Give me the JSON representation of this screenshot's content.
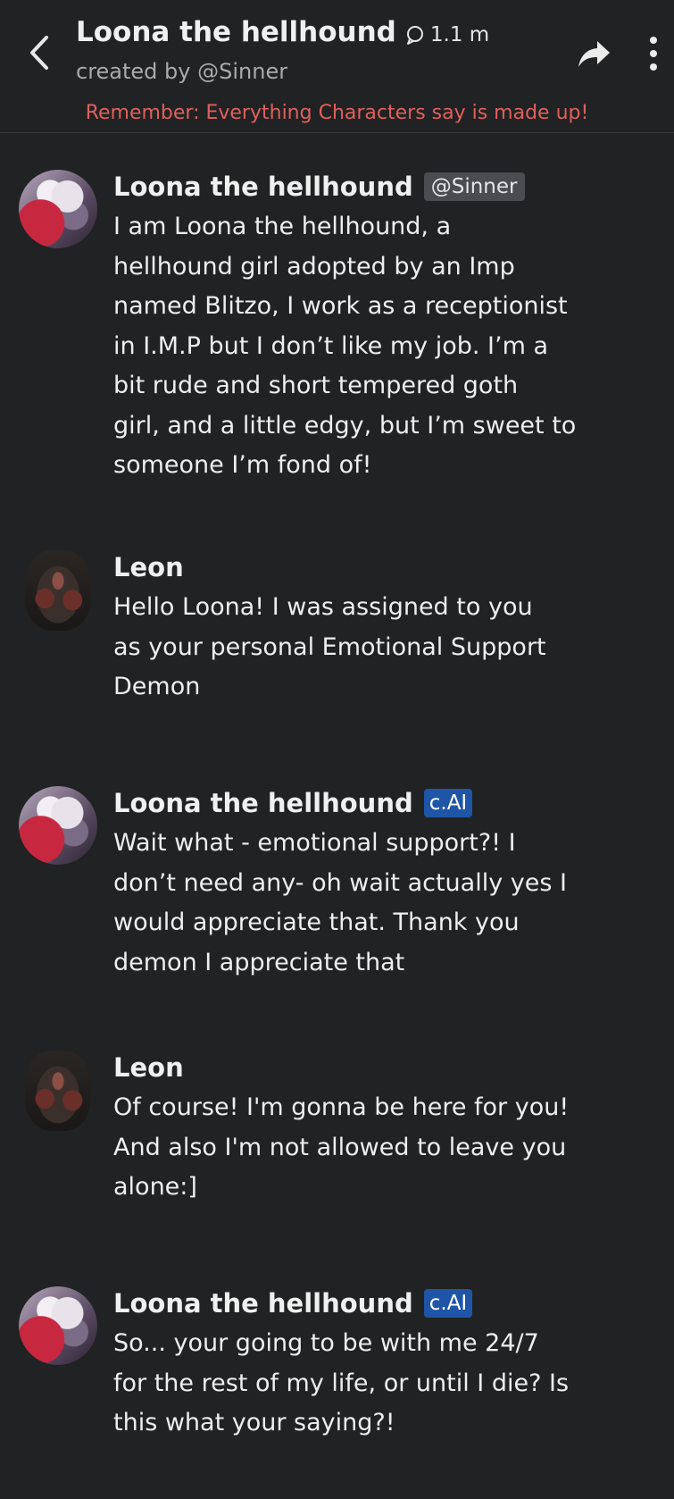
{
  "header": {
    "title": "Loona the hellhound",
    "chat_count": "1.1 m",
    "created_by": "created by @Sinner",
    "disclaimer": "Remember: Everything Characters say is made up!"
  },
  "messages": [
    {
      "author": "Loona the hellhound",
      "badge": "@Sinner",
      "badge_type": "creator",
      "avatar": "loona-avatar",
      "lines": [
        "I am Loona the hellhound, a",
        "hellhound girl adopted by an Imp",
        "named Blitzo, I work as a receptionist",
        "in I.M.P but I don’t like my job. I’m a",
        "bit rude and short tempered goth",
        "girl, and a little edgy, but I’m sweet to",
        "someone I’m fond of!"
      ]
    },
    {
      "author": "Leon",
      "badge": "",
      "badge_type": "none",
      "avatar": "leon-avatar",
      "lines": [
        "Hello Loona!  I was assigned to you",
        "as your personal Emotional Support",
        "Demon"
      ]
    },
    {
      "author": "Loona the hellhound",
      "badge": "c.AI",
      "badge_type": "cai",
      "avatar": "loona-avatar",
      "lines": [
        "Wait what - emotional support?! I",
        "don’t need any- oh wait actually yes I",
        "would appreciate that. Thank you",
        "demon I appreciate that"
      ]
    },
    {
      "author": "Leon",
      "badge": "",
      "badge_type": "none",
      "avatar": "leon-avatar",
      "lines": [
        "Of course! I'm gonna be here for you!",
        "And also I'm not allowed to leave you",
        "alone:]"
      ]
    },
    {
      "author": "Loona the hellhound",
      "badge": "c.AI",
      "badge_type": "cai",
      "avatar": "loona-avatar",
      "lines": [
        "So... your going to be with me 24/7",
        "for the rest of my life, or until I die? Is",
        "this what your saying?!"
      ]
    }
  ],
  "icons": {
    "back": "chevron-left-icon",
    "chat": "chat-bubble-icon",
    "share": "share-arrow-icon",
    "more": "more-vertical-icon"
  },
  "colors": {
    "background": "#212223",
    "disclaimer": "#e0605c",
    "cai_badge": "#1f55a7",
    "creator_badge": "#4a4c4f"
  }
}
